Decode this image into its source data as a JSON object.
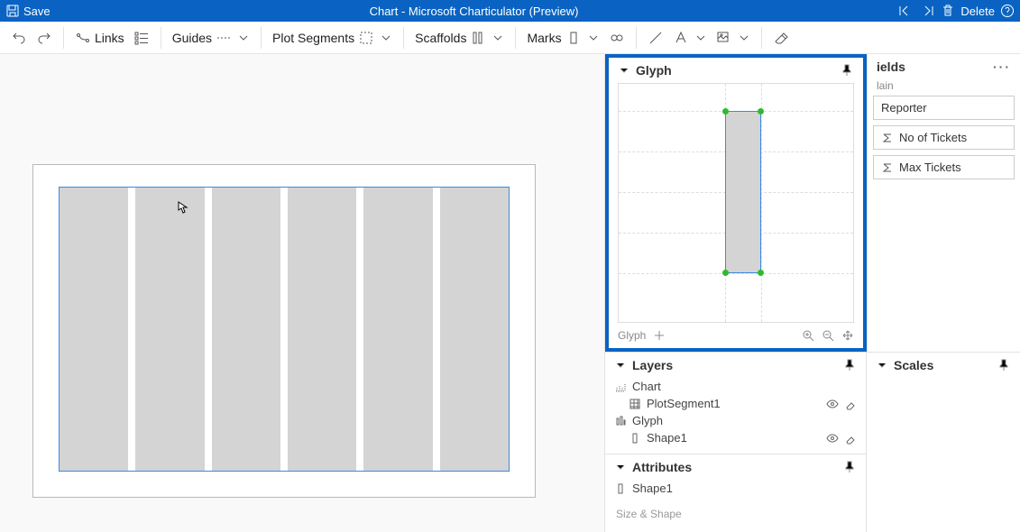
{
  "titlebar": {
    "save_label": "Save",
    "title": "Chart - Microsoft Charticulator (Preview)",
    "delete_label": "Delete"
  },
  "toolbar": {
    "links_label": "Links",
    "guides_label": "Guides",
    "plotsegments_label": "Plot Segments",
    "scaffolds_label": "Scaffolds",
    "marks_label": "Marks"
  },
  "glyph": {
    "panel_title": "Glyph",
    "footer_label": "Glyph"
  },
  "fields": {
    "panel_title": "ields",
    "subhead": "lain",
    "items": [
      "Reporter",
      "No of Tickets",
      "Max Tickets"
    ]
  },
  "layers": {
    "panel_title": "Layers",
    "chart_label": "Chart",
    "plotsegment_label": "PlotSegment1",
    "glyph_label": "Glyph",
    "shape_label": "Shape1"
  },
  "attributes": {
    "panel_title": "Attributes",
    "item_label": "Shape1",
    "section_label": "Size & Shape"
  },
  "scales": {
    "panel_title": "Scales"
  }
}
